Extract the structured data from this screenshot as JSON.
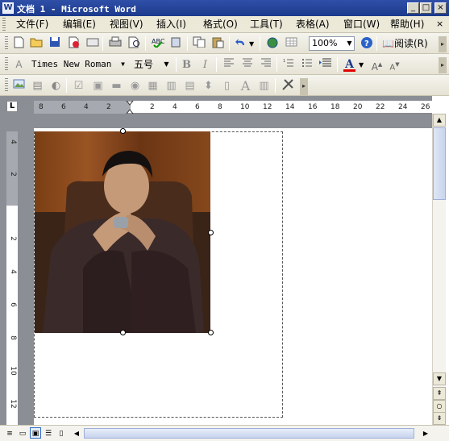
{
  "window": {
    "title": "文档 1 - Microsoft Word",
    "app_icon": "word-icon",
    "controls": {
      "minimize": "_",
      "maximize": "□",
      "close": "×"
    }
  },
  "menu": {
    "items": [
      "文件(F)",
      "编辑(E)",
      "视图(V)",
      "插入(I)",
      "格式(O)",
      "工具(T)",
      "表格(A)",
      "窗口(W)",
      "帮助(H)"
    ],
    "close_glyph": "×"
  },
  "standard_toolbar": {
    "buttons": [
      "new-icon",
      "open-icon",
      "save-icon",
      "permission-icon",
      "email-icon",
      "print-icon",
      "print-preview-icon",
      "spelling-icon",
      "research-icon",
      "copy-icon",
      "paste-icon",
      "undo-icon",
      "hyperlink-icon",
      "table-icon"
    ],
    "zoom": "100%",
    "read_label": "阅读(R)"
  },
  "formatting_toolbar": {
    "font_name": "Times New Roman",
    "font_size": "五号",
    "bold": "B",
    "italic": "I",
    "font_color_glyph": "A",
    "grow_font": "A",
    "shrink_font": "A",
    "font_color": "#e00000"
  },
  "picture_toolbar": {
    "buttons": [
      "insert-picture-icon",
      "color-icon",
      "more-contrast-icon",
      "less-contrast-icon",
      "more-brightness-icon",
      "less-brightness-icon",
      "crop-icon",
      "rotate-icon",
      "line-style-icon",
      "compress-icon",
      "text-wrapping-icon",
      "format-picture-icon",
      "set-transparent-icon",
      "reset-picture-icon"
    ]
  },
  "ruler": {
    "horizontal_labels": [
      "8",
      "6",
      "4",
      "2",
      "2",
      "4",
      "6",
      "8",
      "10",
      "12",
      "14",
      "16",
      "18",
      "20",
      "22",
      "24",
      "26"
    ],
    "vertical_labels": [
      "4",
      "2",
      "2",
      "4",
      "6",
      "8",
      "10",
      "12"
    ],
    "tab_selector": "L"
  },
  "document": {
    "has_picture": true
  },
  "statusbar": {
    "view_buttons": [
      "normal-view-icon",
      "web-layout-view-icon",
      "print-layout-view-icon",
      "outline-view-icon",
      "reading-layout-view-icon"
    ]
  },
  "colors": {
    "titlebar": "#1c3a8c",
    "workspace": "#8c8e96",
    "toolbar": "#ece9d8"
  }
}
